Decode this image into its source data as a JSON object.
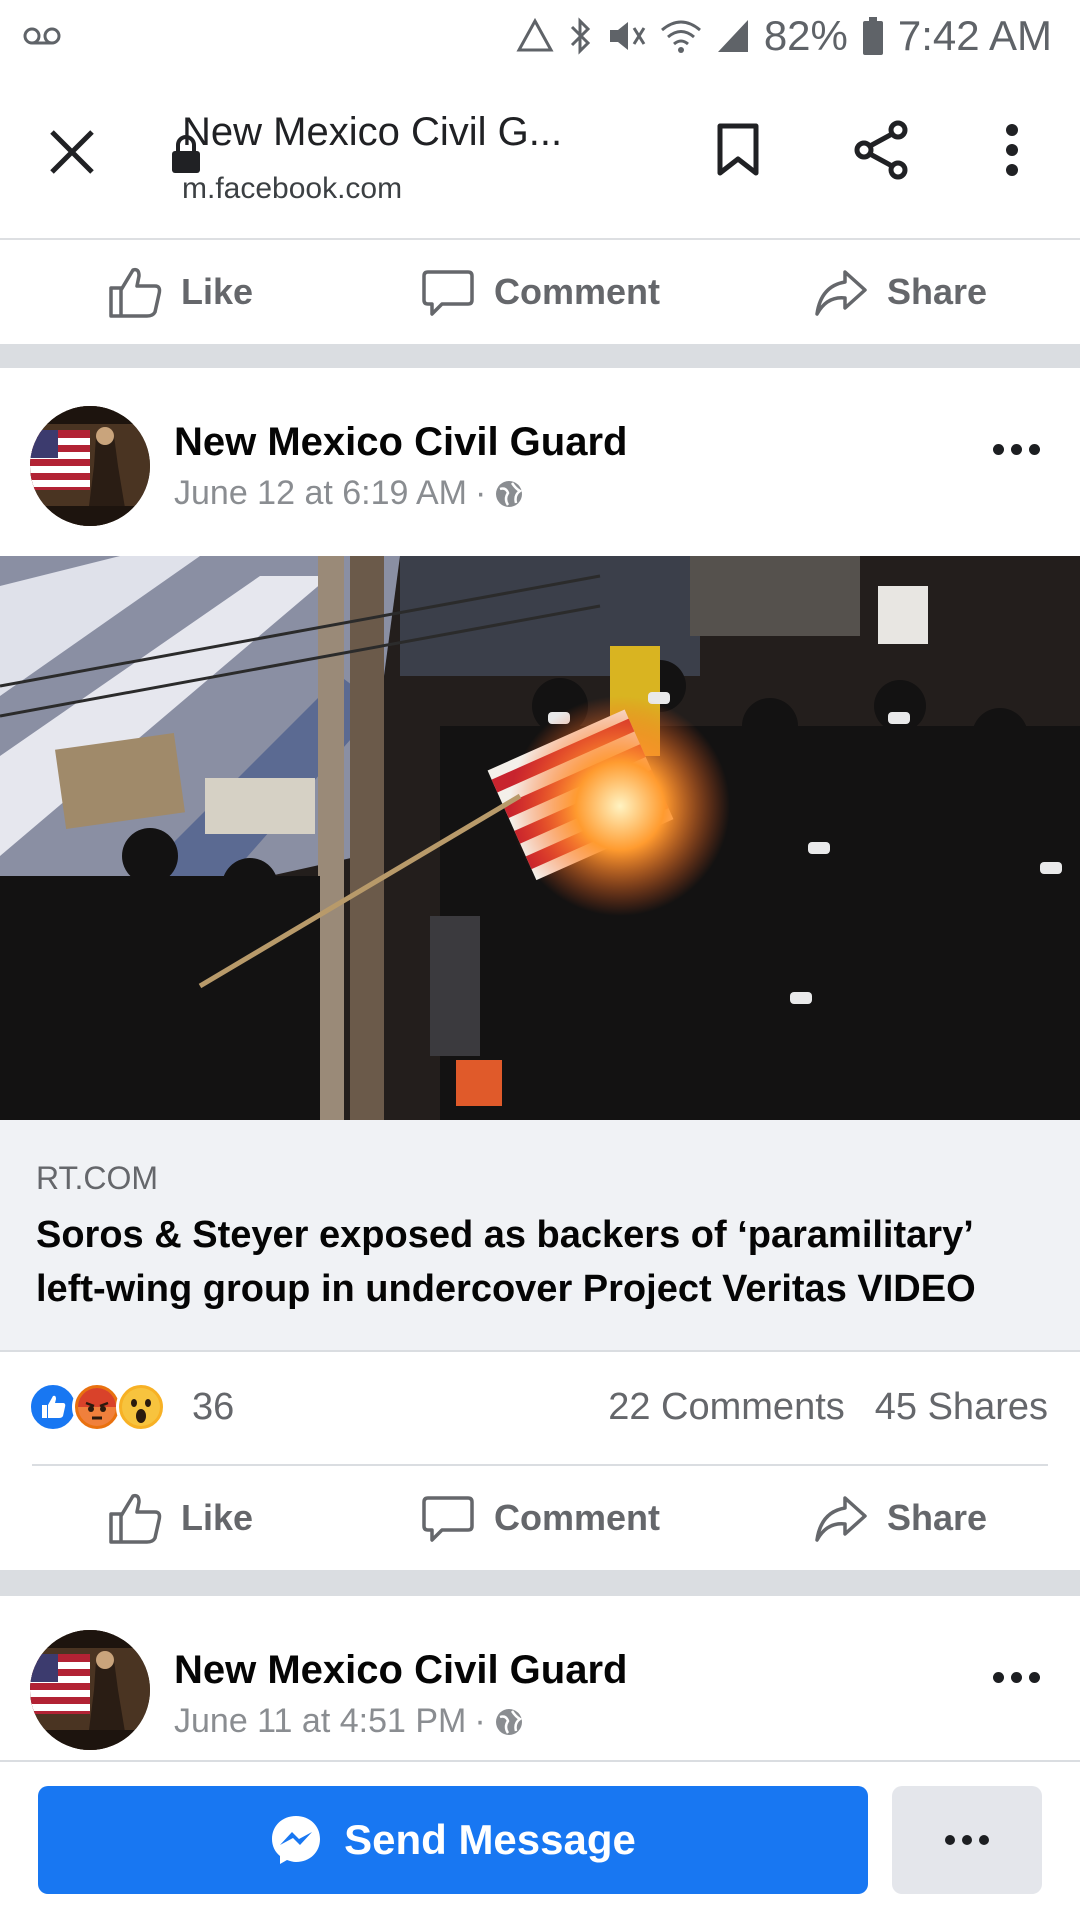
{
  "status_bar": {
    "battery": "82%",
    "time": "7:42 AM"
  },
  "browser": {
    "page_title": "New Mexico Civil G...",
    "host": "m.facebook.com",
    "icons": [
      "close-icon",
      "lock-icon",
      "bookmark-icon",
      "share-icon",
      "overflow-menu-icon"
    ]
  },
  "actions": {
    "like": "Like",
    "comment": "Comment",
    "share": "Share"
  },
  "post1": {
    "author": "New Mexico Civil Guard",
    "date": "June 12 at 6:19 AM",
    "date_sep": "·",
    "link_source": "RT.COM",
    "link_title": "Soros & Steyer exposed as backers of ‘paramilitary’ left-wing group in undercover Project Veritas VIDEO",
    "reaction_count": "36",
    "comments": "22 Comments",
    "shares": "45 Shares",
    "reactions": [
      "like",
      "angry",
      "wow"
    ]
  },
  "post2": {
    "author": "New Mexico Civil Guard",
    "date": "June 11 at 4:51 PM",
    "date_sep": "·"
  },
  "bottom": {
    "send_message": "Send Message"
  },
  "colors": {
    "brand_blue": "#1877f2",
    "muted_text": "#65676b",
    "separator": "#dadde1"
  }
}
